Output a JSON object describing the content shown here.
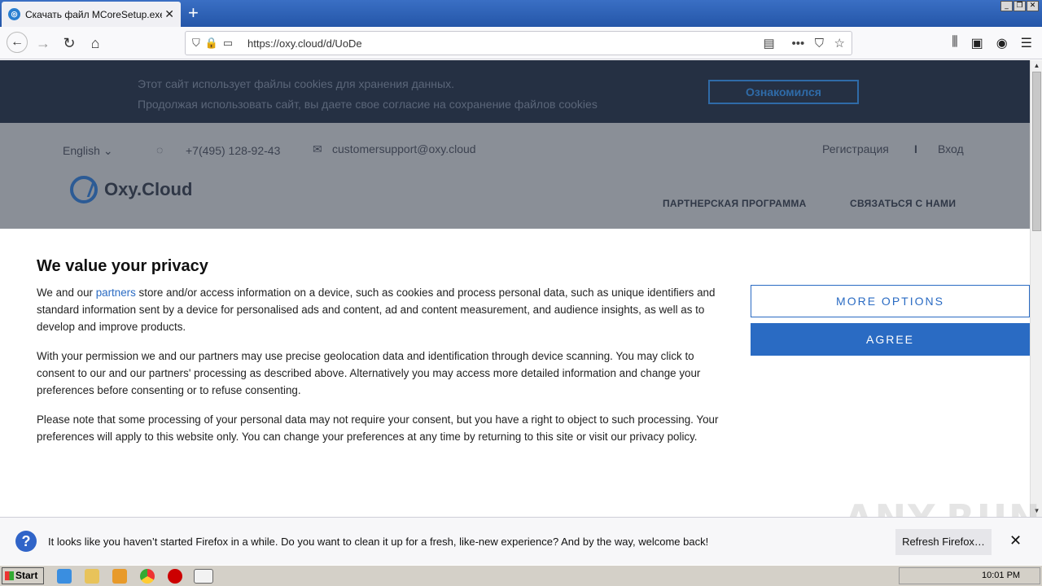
{
  "browser": {
    "tab_title": "Скачать файл MCoreSetup.exe н",
    "url": "https://oxy.cloud/d/UoDe"
  },
  "cookie_banner": {
    "line1": "Этот сайт использует файлы cookies для хранения данных.",
    "line2": "Продолжая использовать сайт, вы даете свое согласие на сохранение файлов cookies",
    "button": "Ознакомился"
  },
  "site_header": {
    "language": "English",
    "phone": "+7(495) 128-92-43",
    "email": "customersupport@oxy.cloud",
    "register": "Регистрация",
    "separator": "I",
    "login": "Вход",
    "logo": "Oxy.Cloud",
    "menu": [
      "ПАРТНЕРСКАЯ ПРОГРАММА",
      "СВЯЗАТЬСЯ С НАМИ"
    ]
  },
  "privacy_dialog": {
    "title": "We value your privacy",
    "p1_before": "We and our ",
    "p1_link": "partners",
    "p1_after": " store and/or access information on a device, such as cookies and process personal data, such as unique identifiers and standard information sent by a device for personalised ads and content, ad and content measurement, and audience insights, as well as to develop and improve products.",
    "p2": "With your permission we and our partners may use precise geolocation data and identification through device scanning. You may click to consent to our and our partners' processing as described above. Alternatively you may access more detailed information and change your preferences before consenting or to refuse consenting.",
    "p3": "Please note that some processing of your personal data may not require your consent, but you have a right to object to such processing. Your preferences will apply to this website only. You can change your preferences at any time by returning to this site or visit our privacy policy.",
    "more_options": "MORE OPTIONS",
    "agree": "AGREE"
  },
  "notification": {
    "text": "It looks like you haven’t started Firefox in a while. Do you want to clean it up for a fresh, like-new experience? And by the way, welcome back!",
    "button": "Refresh Firefox…",
    "close": "✕"
  },
  "taskbar": {
    "start": "Start",
    "clock": "10:01 PM"
  },
  "watermark": "ANY.RUN"
}
